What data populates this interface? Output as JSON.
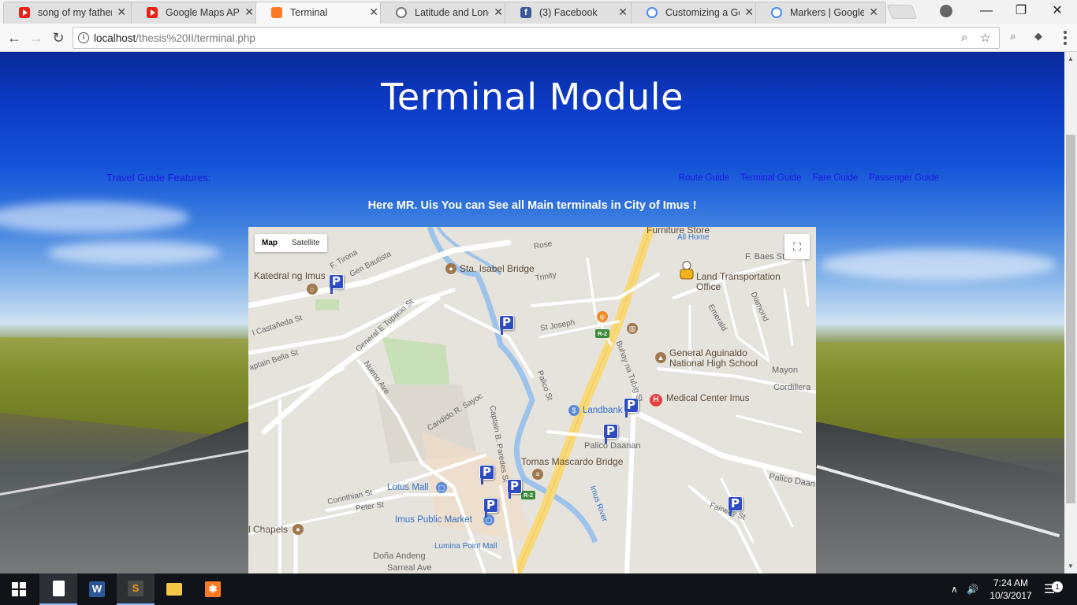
{
  "browser": {
    "tabs": [
      {
        "label": "song of my father",
        "icon": "youtube-icon",
        "active": false
      },
      {
        "label": "Google Maps API \\",
        "icon": "youtube-icon",
        "active": false
      },
      {
        "label": "Terminal",
        "icon": "xampp-icon",
        "active": true
      },
      {
        "label": "Latitude and Long",
        "icon": "compass-icon",
        "active": false
      },
      {
        "label": "(3) Facebook",
        "icon": "facebook-icon",
        "active": false
      },
      {
        "label": "Customizing a Go",
        "icon": "google-developers-icon",
        "active": false
      },
      {
        "label": "Markers  |  Google",
        "icon": "google-developers-icon",
        "active": false
      }
    ],
    "close_glyph": "✕",
    "address": {
      "host": "localhost",
      "path": "/thesis%20II/terminal.php"
    },
    "window_controls": {
      "minimize": "—",
      "restore": "❐",
      "close": "✕"
    }
  },
  "page": {
    "title": "Terminal Module",
    "features_label": "Travel Guide Features:",
    "nav_links": [
      "Route Guide",
      "Terminal Guide",
      "Fare Guide",
      "Passenger Guide"
    ],
    "greeting": "Here MR. Uis You can See all Main terminals in City of Imus !"
  },
  "map": {
    "type_buttons": [
      "Map",
      "Satellite"
    ],
    "selected_type": "Map",
    "labels": {
      "furniture": "Furniture Store",
      "allhome": "All Home",
      "f_baes": "F. Baes St",
      "katedral": "Katedral ng Imus",
      "sta_isabel": "Sta. Isabel Bridge",
      "lto": "Land Transportation",
      "lto2": "Office",
      "gen_aguinaldo": "General Aguinaldo",
      "gen_aguinaldo2": "National High School",
      "medical": "Medical Center Imus",
      "landbank": "Landbank",
      "tomas": "Tomas Mascardo Bridge",
      "lotus": "Lotus Mall",
      "imus_market": "Imus Public Market",
      "lumina": "Lumina Point Mall",
      "chapels": "l Chapels",
      "palico_daanan": "Palico Daanan",
      "palico_daan2": "Palico Daan",
      "mayon": "Mayon",
      "cordillera": "Cordillera",
      "imus_river": "Imus River",
      "fairway": "Fairway St",
      "dona": "Doña Andeng",
      "sarreal": "Sarreal Ave",
      "st_joseph": "St Joseph",
      "trinity": "Trinity",
      "palico_st": "Palico St",
      "candido": "Candido R. Sayoc",
      "corinthian": "Corinthian St",
      "peter": "Peter St",
      "nueno": "Nueno Ave",
      "topacio": "General E Topacio St",
      "castaneda": "l Castañeda St",
      "bella": "aptain Bella St",
      "rose": "Rose",
      "gen_bautista": "Gen Bautista",
      "f_tirona": "F. Tirona",
      "emerald": "Emerald",
      "diamond": "Diamond",
      "buhay": "Buhay na Tubig St",
      "captain_b": "Captain B. Paredes St",
      "r2": "R-2"
    }
  },
  "taskbar": {
    "time": "7:24 AM",
    "date": "10/3/2017",
    "notification_count": "1"
  }
}
